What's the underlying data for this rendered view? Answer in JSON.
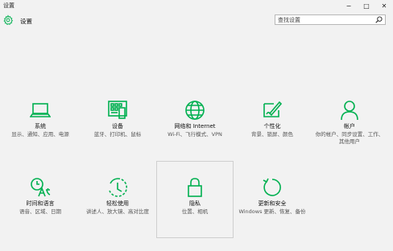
{
  "window": {
    "title": "设置",
    "minimize": "−",
    "maximize": "□",
    "close": "✕"
  },
  "header": {
    "title": "设置",
    "search_placeholder": "查找设置"
  },
  "accent_color": "#00b050",
  "tiles": [
    {
      "label": "系统",
      "desc": "显示、通知、应用、电源",
      "icon": "laptop-icon"
    },
    {
      "label": "设备",
      "desc": "蓝牙、打印机、鼠标",
      "icon": "keyboard-printer-icon"
    },
    {
      "label": "网络和 Internet",
      "desc": "Wi-Fi、飞行模式、VPN",
      "icon": "globe-icon"
    },
    {
      "label": "个性化",
      "desc": "背景、锁屏、颜色",
      "icon": "paint-icon"
    },
    {
      "label": "帐户",
      "desc": "你的帐户、同步设置、工作、其他用户",
      "icon": "person-icon"
    },
    {
      "label": "时间和语言",
      "desc": "语音、区域、日期",
      "icon": "time-language-icon"
    },
    {
      "label": "轻松使用",
      "desc": "讲述人、放大镜、高对比度",
      "icon": "ease-of-access-icon"
    },
    {
      "label": "隐私",
      "desc": "位置、相机",
      "icon": "lock-icon"
    },
    {
      "label": "更新和安全",
      "desc": "Windows 更新、恢复、备份",
      "icon": "refresh-icon"
    }
  ]
}
